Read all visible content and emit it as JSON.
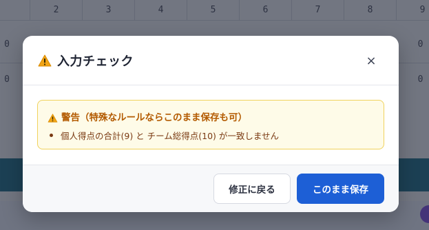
{
  "background": {
    "column_numbers": [
      "2",
      "3",
      "4",
      "5",
      "6",
      "7",
      "8",
      "9"
    ],
    "left_values": [
      "0",
      "0"
    ],
    "right_values": [
      "0",
      "0"
    ]
  },
  "modal": {
    "title": "入力チェック",
    "close_label": "×",
    "warning": {
      "title": "警告（特殊なルールならこのまま保存も可）",
      "items": [
        "個人得点の合計(9) と チーム総得点(10) が一致しません"
      ]
    },
    "buttons": {
      "back_label": "修正に戻る",
      "save_label": "このまま保存"
    }
  },
  "colors": {
    "warning_text": "#b35a00",
    "warning_border": "#f0d25c",
    "warning_bg": "#fefbe8",
    "primary_button": "#1d5fd6",
    "warning_icon": "#f2a516"
  },
  "icons": {
    "title_icon": "warning-triangle-icon",
    "warning_box_icon": "warning-triangle-icon",
    "close_icon": "close-icon"
  }
}
